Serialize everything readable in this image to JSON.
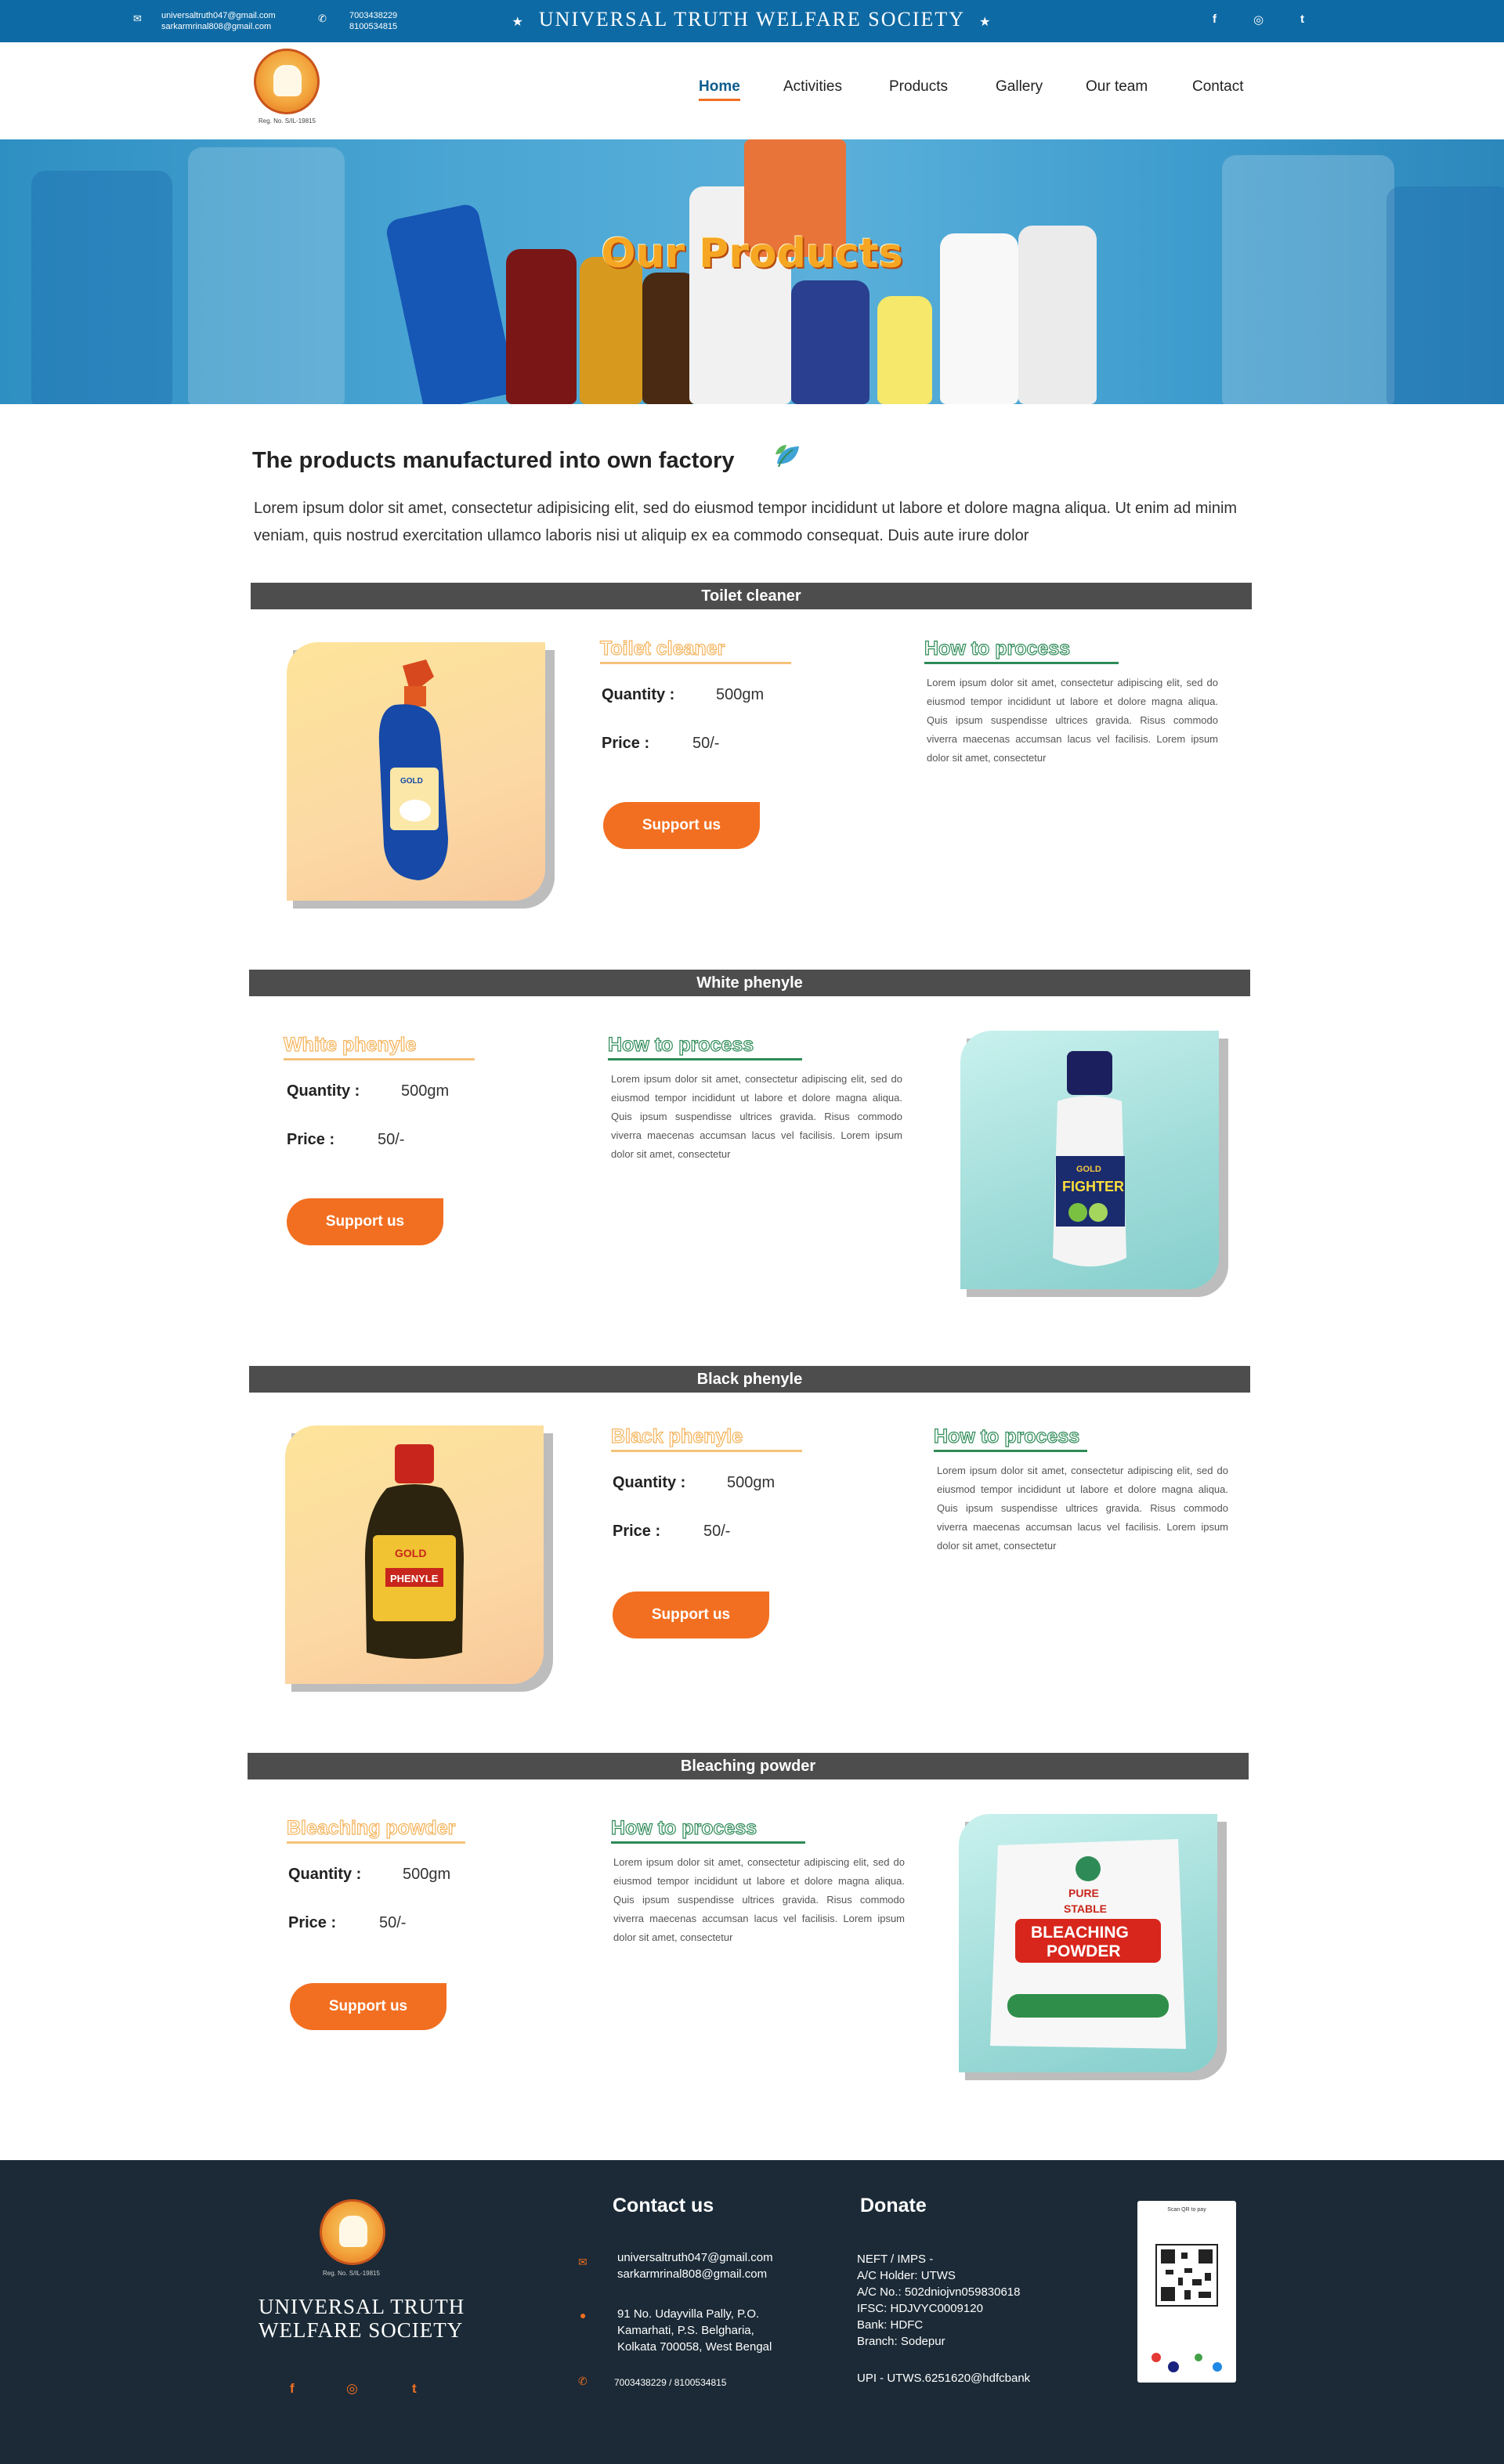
{
  "topbar": {
    "email_1": "universaltruth047@gmail.com",
    "email_2": "sarkarmrinal808@gmail.com",
    "phone_1": "7003438229",
    "phone_2": "8100534815",
    "title": "UNIVERSAL TRUTH WELFARE SOCIETY",
    "star_left": "★",
    "star_right": "★",
    "social": [
      "f",
      "◎",
      "t"
    ]
  },
  "nav": {
    "logo_reg": "Reg. No. S/IL-19815",
    "items": [
      "Home",
      "Activities",
      "Products",
      "Gallery",
      "Our team",
      "Contact"
    ],
    "active": "Home"
  },
  "hero": {
    "title": "Our Products"
  },
  "intro": {
    "title": "The products manufactured into own factory",
    "text": "Lorem ipsum dolor sit amet, consectetur adipisicing elit, sed do eiusmod tempor incididunt ut labore et dolore magna aliqua. Ut enim ad minim veniam, quis nostrud exercitation ullamco laboris nisi ut aliquip ex ea commodo consequat. Duis aute irure dolor"
  },
  "products": [
    {
      "band": "Toilet cleaner",
      "name": "Toilet cleaner",
      "quantity_label": "Quantity :",
      "quantity": "500gm",
      "price_label": "Price :",
      "price": "50/-",
      "button": "Support us",
      "how_title": "How to process",
      "how_text": "Lorem ipsum dolor sit amet, consectetur adipiscing elit, sed do eiusmod tempor incididunt ut labore et dolore magna aliqua. Quis ipsum suspendisse ultrices gravida. Risus commodo viverra maecenas accumsan lacus vel facilisis. Lorem ipsum dolor sit amet, consectetur"
    },
    {
      "band": "White phenyle",
      "name": "White phenyle",
      "quantity_label": "Quantity :",
      "quantity": "500gm",
      "price_label": "Price :",
      "price": "50/-",
      "button": "Support us",
      "how_title": "How to process",
      "how_text": "Lorem ipsum dolor sit amet, consectetur adipiscing elit, sed do eiusmod tempor incididunt ut labore et dolore magna aliqua. Quis ipsum suspendisse ultrices gravida. Risus commodo viverra maecenas accumsan lacus vel facilisis. Lorem ipsum dolor sit amet, consectetur"
    },
    {
      "band": "Black phenyle",
      "name": "Black phenyle",
      "quantity_label": "Quantity :",
      "quantity": "500gm",
      "price_label": "Price :",
      "price": "50/-",
      "button": "Support us",
      "how_title": "How to process",
      "how_text": "Lorem ipsum dolor sit amet, consectetur adipiscing elit, sed do eiusmod tempor incididunt ut labore et dolore magna aliqua. Quis ipsum suspendisse ultrices gravida. Risus commodo viverra maecenas accumsan lacus vel facilisis. Lorem ipsum dolor sit amet, consectetur"
    },
    {
      "band": "Bleaching powder",
      "name": "Bleaching powder",
      "quantity_label": "Quantity :",
      "quantity": "500gm",
      "price_label": "Price :",
      "price": "50/-",
      "button": "Support us",
      "how_title": "How to process",
      "how_text": "Lorem ipsum dolor sit amet, consectetur adipiscing elit, sed do eiusmod tempor incididunt ut labore et dolore magna aliqua. Quis ipsum suspendisse ultrices gravida. Risus commodo viverra maecenas accumsan lacus vel facilisis. Lorem ipsum dolor sit amet, consectetur"
    }
  ],
  "product_images": {
    "label_gold": "GOLD",
    "label_fighter": "FIGHTER",
    "label_phenyle": "PHENYLE",
    "label_pure": "PURE",
    "label_stable": "STABLE",
    "label_bleaching": "BLEACHING",
    "label_powder": "POWDER"
  },
  "footer": {
    "logo_reg": "Reg. No. S/IL-19815",
    "name_line1": "UNIVERSAL TRUTH",
    "name_line2": "WELFARE SOCIETY",
    "social": [
      "f",
      "◎",
      "t"
    ],
    "contact_title": "Contact us",
    "email_1": "universaltruth047@gmail.com",
    "email_2": "sarkarmrinal808@gmail.com",
    "address_1": "91 No. Udayvilla Pally, P.O.",
    "address_2": "Kamarhati, P.S. Belgharia,",
    "address_3": "Kolkata 700058, West Bengal",
    "phones": "7003438229 / 8100534815",
    "donate_title": "Donate",
    "donate_lines": [
      "NEFT / IMPS -",
      "A/C Holder: UTWS",
      "A/C No.: 502dniojvn059830618",
      "IFSC: HDJVYC0009120",
      "Bank: HDFC",
      "Branch: Sodepur"
    ],
    "upi": "UPI - UTWS.6251620@hdfcbank",
    "qr_caption": "Scan QR to pay"
  },
  "colors": {
    "topbar": "#0e6aa4",
    "accent": "#f26f21",
    "band": "#4d4d4d",
    "footer": "#1b2a36",
    "how_green": "#2e8b57"
  }
}
